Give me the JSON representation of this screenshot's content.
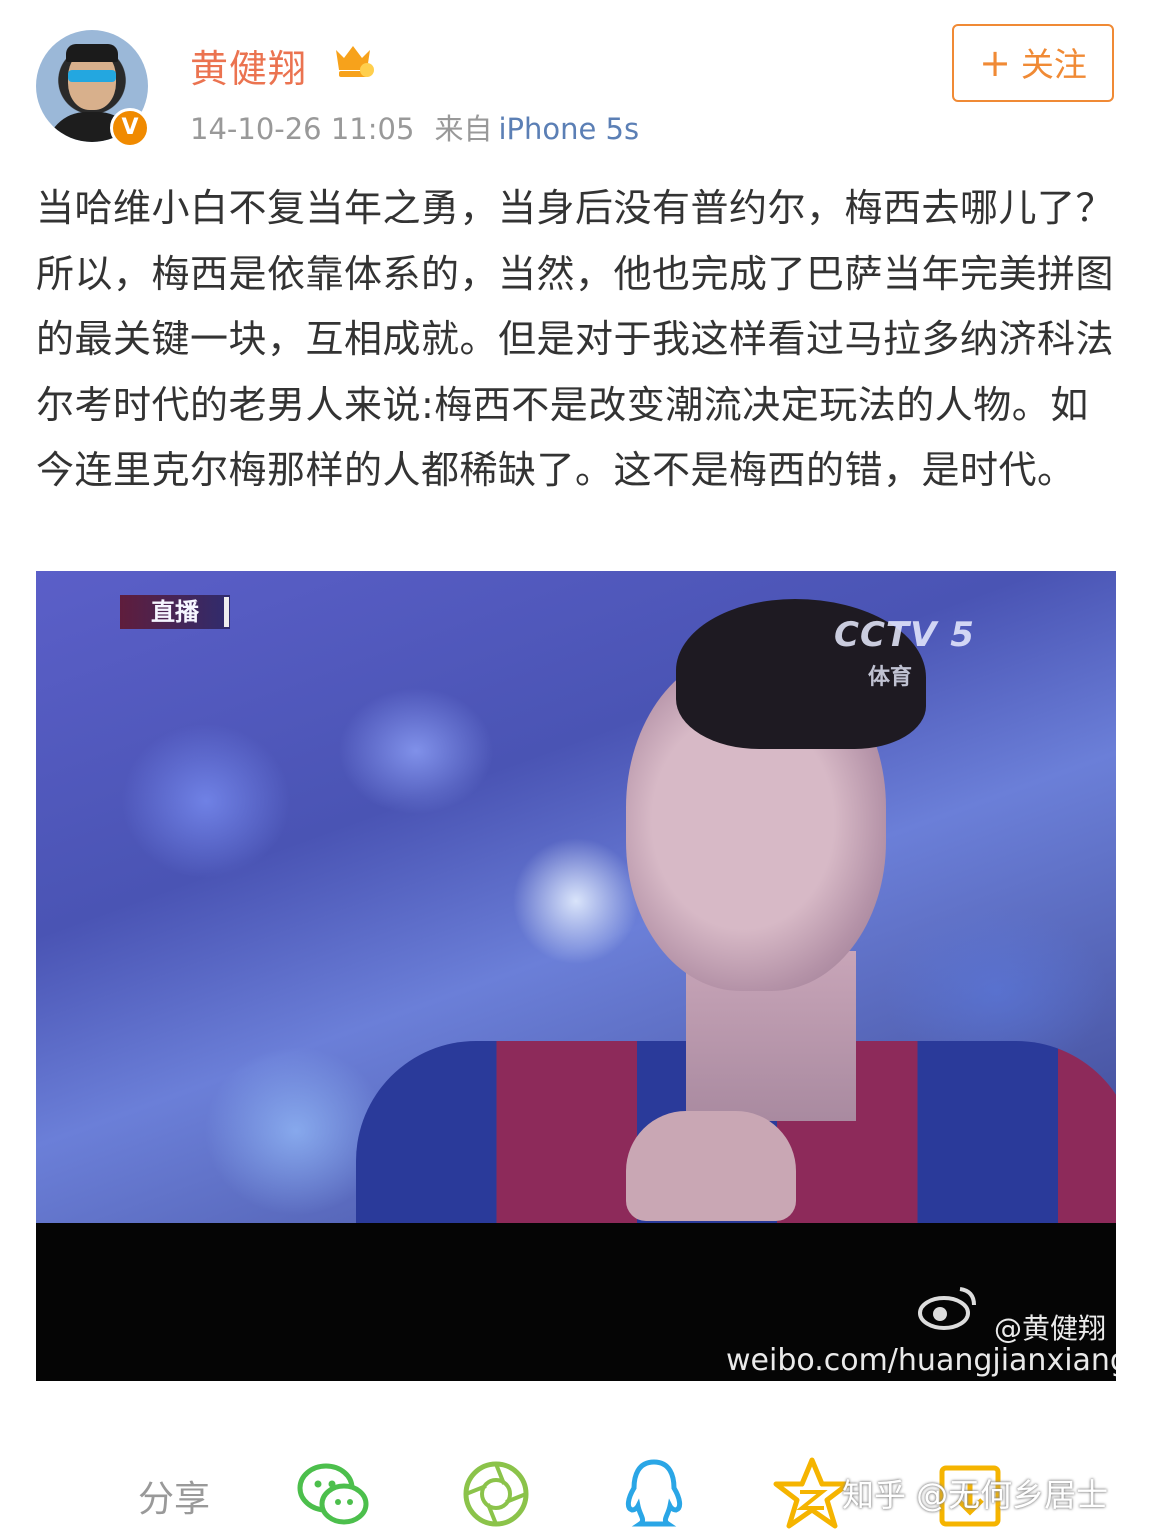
{
  "post": {
    "author": "黄健翔",
    "time": "14-10-26 11:05",
    "from_label": "来自",
    "source": "iPhone 5s",
    "verified_mark": "V",
    "follow_label": "关注",
    "follow_plus": "+",
    "text": "当哈维小白不复当年之勇，当身后没有普约尔，梅西去哪儿了？所以，梅西是依靠体系的，当然，他也完成了巴萨当年完美拼图的最关键一块，互相成就。但是对于我这样看过马拉多纳济科法尔考时代的老男人来说:梅西不是改变潮流决定玩法的人物。如今连里克尔梅那样的人都稀缺了。这不是梅西的错，是时代。"
  },
  "image": {
    "live_tag": "直播",
    "channel_logo": "CCTV 5",
    "channel_sub": "体育",
    "watermark_handle": "@黄健翔",
    "watermark_url": "weibo.com/huangjianxiang"
  },
  "share": {
    "label": "分享",
    "targets": [
      "wechat-icon",
      "moments-icon",
      "qq-icon",
      "qzone-icon",
      "favorite-icon"
    ]
  },
  "overlay_watermark": "知乎 @无何乡居士",
  "colors": {
    "username": "#eb7350",
    "follow": "#f08a35",
    "link": "#5b7fb5",
    "wechat": "#4cbf4c",
    "qq": "#2aa6e6",
    "qzone": "#f5b400"
  }
}
